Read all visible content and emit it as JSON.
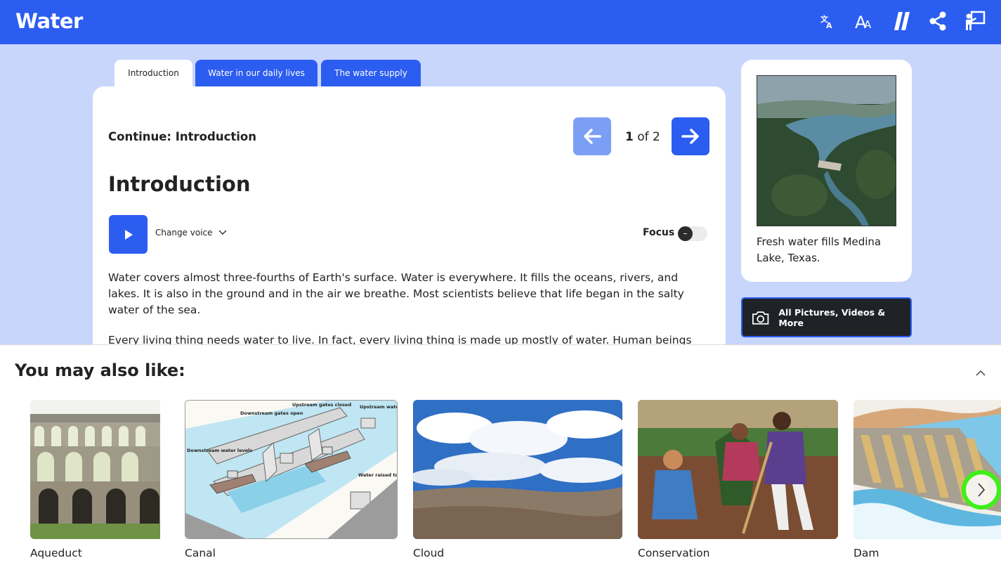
{
  "app": {
    "title": "Water"
  },
  "toolbar": {
    "icons": [
      "translate-icon",
      "text-size-icon",
      "reading-level-icon",
      "share-icon",
      "teacher-icon"
    ]
  },
  "tabs": [
    {
      "label": "Introduction",
      "active": true
    },
    {
      "label": "Water in our daily lives",
      "active": false
    },
    {
      "label": "The water supply",
      "active": false
    }
  ],
  "article": {
    "continue_label": "Continue: Introduction",
    "page_current": "1",
    "page_of": "of 2",
    "title": "Introduction",
    "change_voice": "Change voice",
    "focus_label": "Focus",
    "focus_on": false,
    "paragraphs": [
      "Water covers almost three-fourths of Earth's surface. Water is everywhere. It fills the oceans, rivers, and lakes. It is also in the ground and in the air we breathe. Most scientists believe that life began in the salty water of the sea.",
      "Every living thing needs water to live. In fact, every living thing is made up mostly of water. Human beings can"
    ]
  },
  "sidebar": {
    "caption": "Fresh water fills Medina Lake, Texas.",
    "all_pictures": "All Pictures, Videos & More"
  },
  "related": {
    "heading": "You may also like:",
    "items": [
      {
        "label": "Aqueduct"
      },
      {
        "label": "Canal"
      },
      {
        "label": "Cloud"
      },
      {
        "label": "Conservation"
      },
      {
        "label": "Dam"
      }
    ],
    "canal_diagram_labels": [
      "Downstream gates open",
      "Upstream gates closed",
      "Upstream water levels",
      "Downstream water levels",
      "Water raised to upstream level"
    ]
  },
  "colors": {
    "brand": "#2c5df1",
    "background": "#c9d6fc",
    "highlight": "#3ef018"
  }
}
